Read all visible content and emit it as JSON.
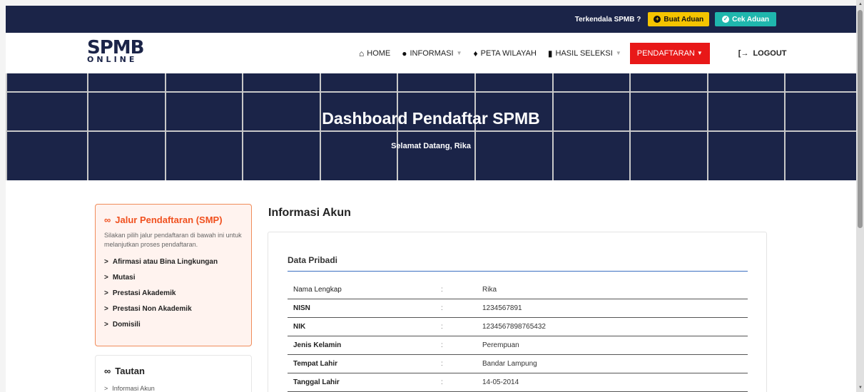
{
  "topbar": {
    "question": "Terkendala SPMB ?",
    "buat_aduan": "Buat Aduan",
    "cek_aduan": "Cek Aduan"
  },
  "logo": {
    "line1": "SPMB",
    "line2": "ONLINE"
  },
  "nav": {
    "home": "HOME",
    "informasi": "INFORMASI",
    "peta_wilayah": "PETA WILAYAH",
    "hasil_seleksi": "HASIL SELEKSI",
    "pendaftaran": "PENDAFTARAN",
    "logout": "LOGOUT"
  },
  "hero": {
    "title": "Dashboard Pendaftar SPMB",
    "subtitle": "Selamat Datang, Rika"
  },
  "jalur": {
    "title": "Jalur Pendaftaran (SMP)",
    "description": "Silakan pilih jalur pendaftaran di bawah ini untuk melanjutkan proses pendaftaran.",
    "items": [
      {
        "label": "Afirmasi atau Bina Lingkungan"
      },
      {
        "label": "Mutasi"
      },
      {
        "label": "Prestasi Akademik"
      },
      {
        "label": "Prestasi Non Akademik"
      },
      {
        "label": "Domisili"
      }
    ]
  },
  "tautan": {
    "title": "Tautan",
    "items": [
      {
        "label": "Informasi Akun"
      }
    ]
  },
  "main": {
    "title": "Informasi Akun",
    "section": "Data Pribadi",
    "separator": ":",
    "rows": [
      {
        "label": "Nama Lengkap",
        "value": "Rika"
      },
      {
        "label": "NISN",
        "value": "1234567891"
      },
      {
        "label": "NIK",
        "value": "1234567898765432"
      },
      {
        "label": "Jenis Kelamin",
        "value": "Perempuan"
      },
      {
        "label": "Tempat Lahir",
        "value": "Bandar Lampung"
      },
      {
        "label": "Tanggal Lahir",
        "value": "14-05-2014"
      }
    ]
  },
  "colors": {
    "navy": "#1b2448",
    "accent_red": "#e81818",
    "aduan_yellow": "#f5c400",
    "cek_teal": "#1fb6ad",
    "jalur_orange": "#f0501e"
  }
}
